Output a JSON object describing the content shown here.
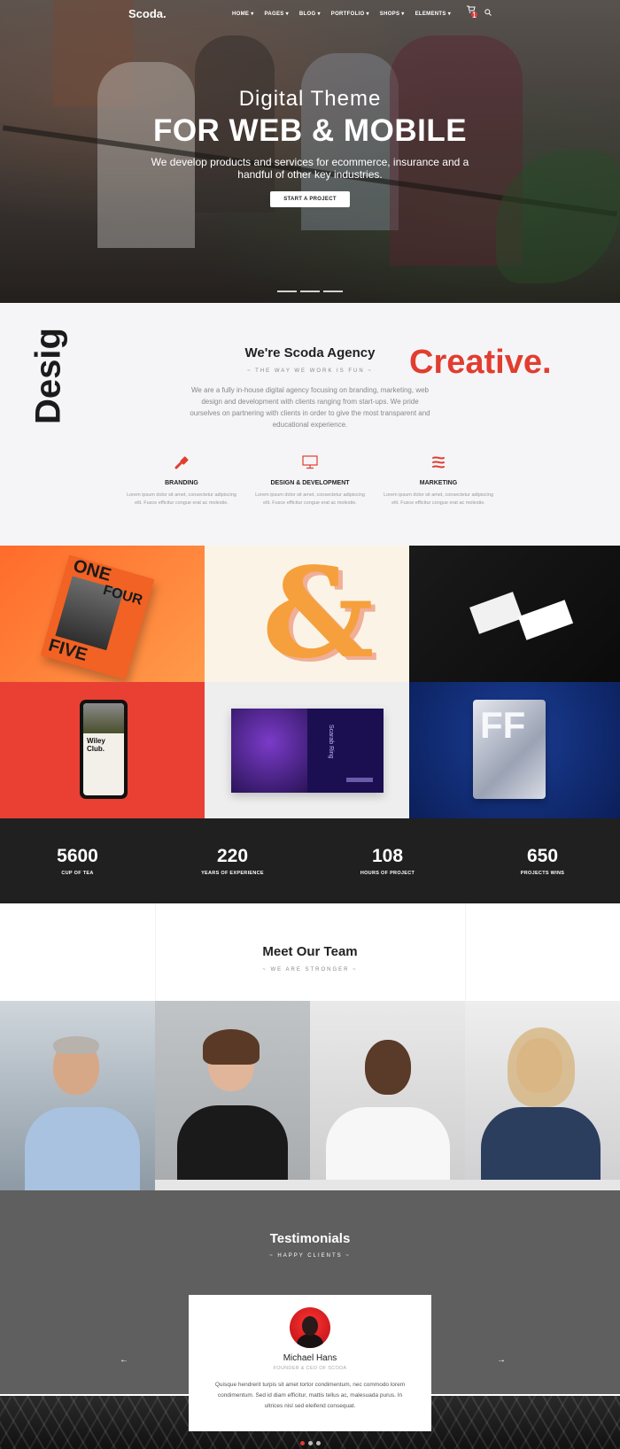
{
  "header": {
    "logo": "Scoda.",
    "menu": [
      {
        "label": "HOME"
      },
      {
        "label": "PAGES"
      },
      {
        "label": "BLOG"
      },
      {
        "label": "PORTFOLIO"
      },
      {
        "label": "SHOPS"
      },
      {
        "label": "ELEMENTS"
      }
    ],
    "cart_count": "1",
    "cart_icon": "cart-icon",
    "search_icon": "search-icon"
  },
  "hero": {
    "subtitle": "Digital Theme",
    "title": "FOR WEB & MOBILE",
    "description": "We develop products and services for ecommerce, insurance and a handful of other key industries.",
    "button": "START A PROJECT"
  },
  "agency": {
    "vertical_word": "Desig",
    "accent_word": "Creative.",
    "title": "We're Scoda Agency",
    "tagline": "~ THE WAY WE WORK IS FUN ~",
    "description": "We are a fully in-house digital agency focusing on branding, marketing, web design and development with clients ranging from start-ups. We pride ourselves on partnering with clients in order to give the most transparent and educational experience.",
    "services": [
      {
        "title": "BRANDING",
        "icon": "brush-icon",
        "text": "Lorem ipsum dolor sit amet, consectetur adipiscing elit. Fusce efficitur congue erat ac molestie."
      },
      {
        "title": "DESIGN & DEVELOPMENT",
        "icon": "monitor-icon",
        "text": "Lorem ipsum dolor sit amet, consectetur adipiscing elit. Fusce efficitur congue erat ac molestie."
      },
      {
        "title": "MARKETING",
        "icon": "megaphone-icon",
        "text": "Lorem ipsum dolor sit amet, consectetur adipiscing elit. Fusce efficitur congue erat ac molestie."
      }
    ]
  },
  "portfolio": {
    "poster_words": [
      "ONE",
      "FOUR",
      "FIVE"
    ],
    "ampersand": "&",
    "phone_text": "Wiley Club.",
    "book_text": "Scarab Ring",
    "bag_text": "FF"
  },
  "stats": [
    {
      "number": "5600",
      "label": "CUP OF TEA"
    },
    {
      "number": "220",
      "label": "YEARS OF EXPERIENCE"
    },
    {
      "number": "108",
      "label": "HOURS OF PROJECT"
    },
    {
      "number": "650",
      "label": "PROJECTS WINS"
    }
  ],
  "team": {
    "title": "Meet Our Team",
    "tagline": "~ WE ARE STRONGER ~"
  },
  "testimonials": {
    "title": "Testimonials",
    "tagline": "~ HAPPY CLIENTS ~",
    "name": "Michael Hans",
    "role": "FOUNDER & CEO OF SCODA",
    "quote": "Quisque hendrerit turpis sit amet tortor condimentum, nec commodo lorem condimentum. Sed id diam efficitur, mattis tellus ac, malesuada purus. In ultrices nisl sed eleifend consequat.",
    "prev_icon": "arrow-left-icon",
    "next_icon": "arrow-right-icon"
  },
  "colors": {
    "accent": "#e23d2f",
    "dark": "#202020",
    "testimonial_bg": "#5f5f5f"
  }
}
